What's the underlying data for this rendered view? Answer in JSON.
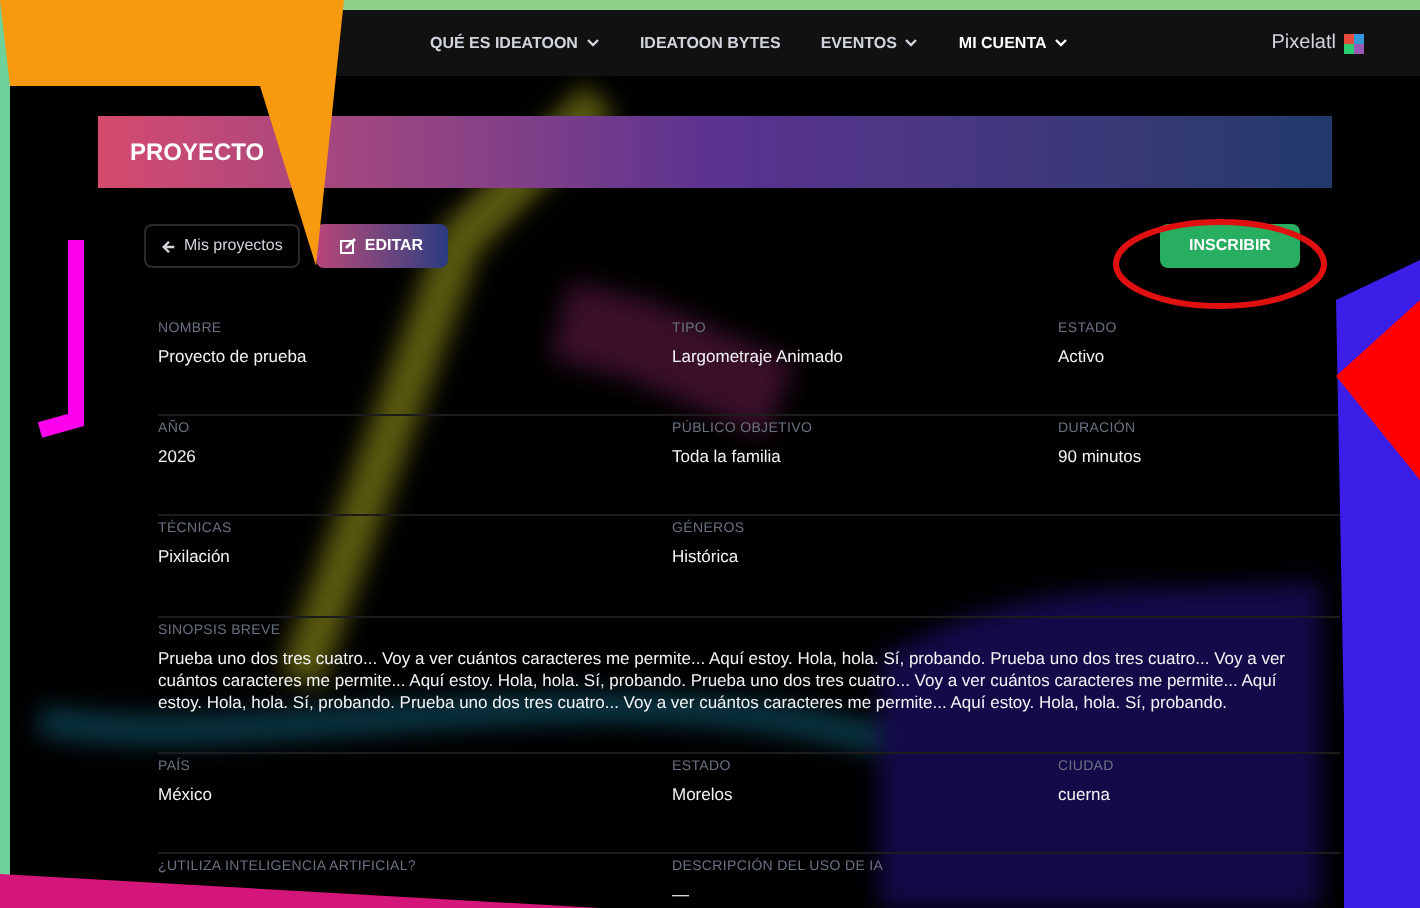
{
  "nav": {
    "items": [
      {
        "label": "QUÉ ES IDEATOON",
        "dropdown": true,
        "active": false
      },
      {
        "label": "IDEATOON BYTES",
        "dropdown": false,
        "active": false
      },
      {
        "label": "EVENTOS",
        "dropdown": true,
        "active": false
      },
      {
        "label": "MI CUENTA",
        "dropdown": true,
        "active": true
      }
    ],
    "brand": "Pixelatl"
  },
  "panel": {
    "title": "PROYECTO"
  },
  "actions": {
    "back": "Mis proyectos",
    "edit": "EDITAR",
    "enroll": "INSCRIBIR"
  },
  "rows": [
    [
      {
        "label": "NOMBRE",
        "value": "Proyecto de prueba"
      },
      {
        "label": "TIPO",
        "value": "Largometraje Animado"
      },
      {
        "label": "ESTADO",
        "value": "Activo"
      }
    ],
    [
      {
        "label": "AÑO",
        "value": "2026"
      },
      {
        "label": "PÚBLICO OBJETIVO",
        "value": "Toda la familia"
      },
      {
        "label": "DURACIÓN",
        "value": "90 minutos"
      }
    ],
    [
      {
        "label": "TÉCNICAS",
        "value": "Pixilación"
      },
      {
        "label": "GÉNEROS",
        "value": "Histórica"
      }
    ],
    [
      {
        "label": "SINOPSIS BREVE",
        "value": "Prueba uno dos tres cuatro... Voy a ver cuántos caracteres me permite... Aquí estoy. Hola, hola. Sí, probando. Prueba uno dos tres cuatro... Voy a ver cuántos caracteres me permite... Aquí estoy. Hola, hola. Sí, probando. Prueba uno dos tres cuatro... Voy a ver cuántos caracteres me permite... Aquí estoy. Hola, hola. Sí, probando. Prueba uno dos tres cuatro... Voy a ver cuántos caracteres me permite... Aquí estoy. Hola, hola. Sí, probando.",
        "wide": true
      }
    ],
    [
      {
        "label": "PAÍS",
        "value": "México"
      },
      {
        "label": "ESTADO",
        "value": "Morelos"
      },
      {
        "label": "CIUDAD",
        "value": "cuerna"
      }
    ],
    [
      {
        "label": "¿UTILIZA INTELIGENCIA ARTIFICIAL?"
      },
      {
        "label": "DESCRIPCIÓN DEL USO DE IA",
        "value": "—"
      }
    ]
  ]
}
